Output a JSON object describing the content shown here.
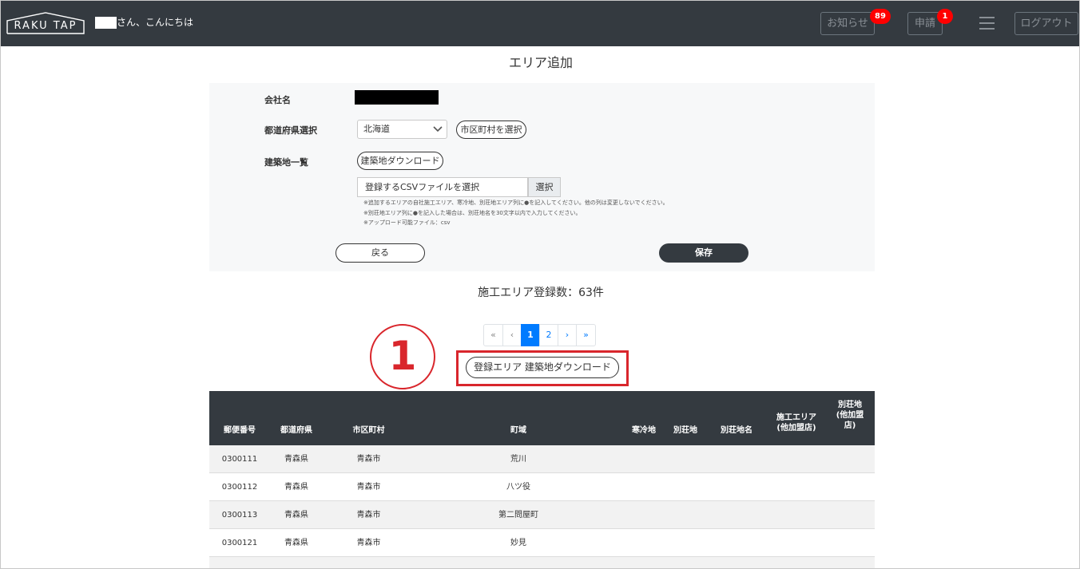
{
  "header": {
    "logo_text": "RAKU TAP",
    "greeting": "さん、こんにちは",
    "notice_label": "お知らせ",
    "notice_count": "89",
    "apply_label": "申請",
    "apply_count": "1",
    "logout_label": "ログアウト"
  },
  "page": {
    "title": "エリア追加"
  },
  "form": {
    "company_label": "会社名",
    "prefecture_label": "都道府県選択",
    "prefecture_value": "北海道",
    "city_select_label": "市区町村を選択",
    "site_list_label": "建築地一覧",
    "site_download_label": "建築地ダウンロード",
    "csv_placeholder": "登録するCSVファイルを選択",
    "csv_select_label": "選択",
    "notes": [
      "※追加するエリアの自社施工エリア、寒冷地、別荘地エリア列に●を記入してください。他の列は変更しないでください。",
      "※別荘地エリア列に●を記入した場合は、別荘地名を30文字以内で入力してください。",
      "※アップロード可能ファイル：csv"
    ],
    "back_label": "戻る",
    "save_label": "保存"
  },
  "summary": {
    "count_text": "施工エリア登録数：63件"
  },
  "pagination": {
    "first": "«",
    "prev": "‹",
    "pages": [
      "1",
      "2"
    ],
    "next": "›",
    "last": "»",
    "current": "1"
  },
  "annotation": {
    "number": "1"
  },
  "download_button_label": "登録エリア 建築地ダウンロード",
  "table": {
    "headers": {
      "zip": "郵便番号",
      "pref": "都道府県",
      "city": "市区町村",
      "town": "町域",
      "cold": "寒冷地",
      "villa": "別荘地",
      "villa_name": "別荘地名",
      "area_line1": "施工エリア",
      "area_line2": "(他加盟店)",
      "villa2_line1": "別荘地",
      "villa2_line2": "(他加盟",
      "villa2_line3": "店)"
    },
    "rows": [
      {
        "zip": "0300111",
        "pref": "青森県",
        "city": "青森市",
        "town": "荒川"
      },
      {
        "zip": "0300112",
        "pref": "青森県",
        "city": "青森市",
        "town": "八ツ役"
      },
      {
        "zip": "0300113",
        "pref": "青森県",
        "city": "青森市",
        "town": "第二問屋町"
      },
      {
        "zip": "0300121",
        "pref": "青森県",
        "city": "青森市",
        "town": "妙見"
      }
    ]
  },
  "colors": {
    "header_bg": "#343a40",
    "badge": "#ff0000",
    "accent": "#007bff",
    "annotation": "#d9262c"
  }
}
